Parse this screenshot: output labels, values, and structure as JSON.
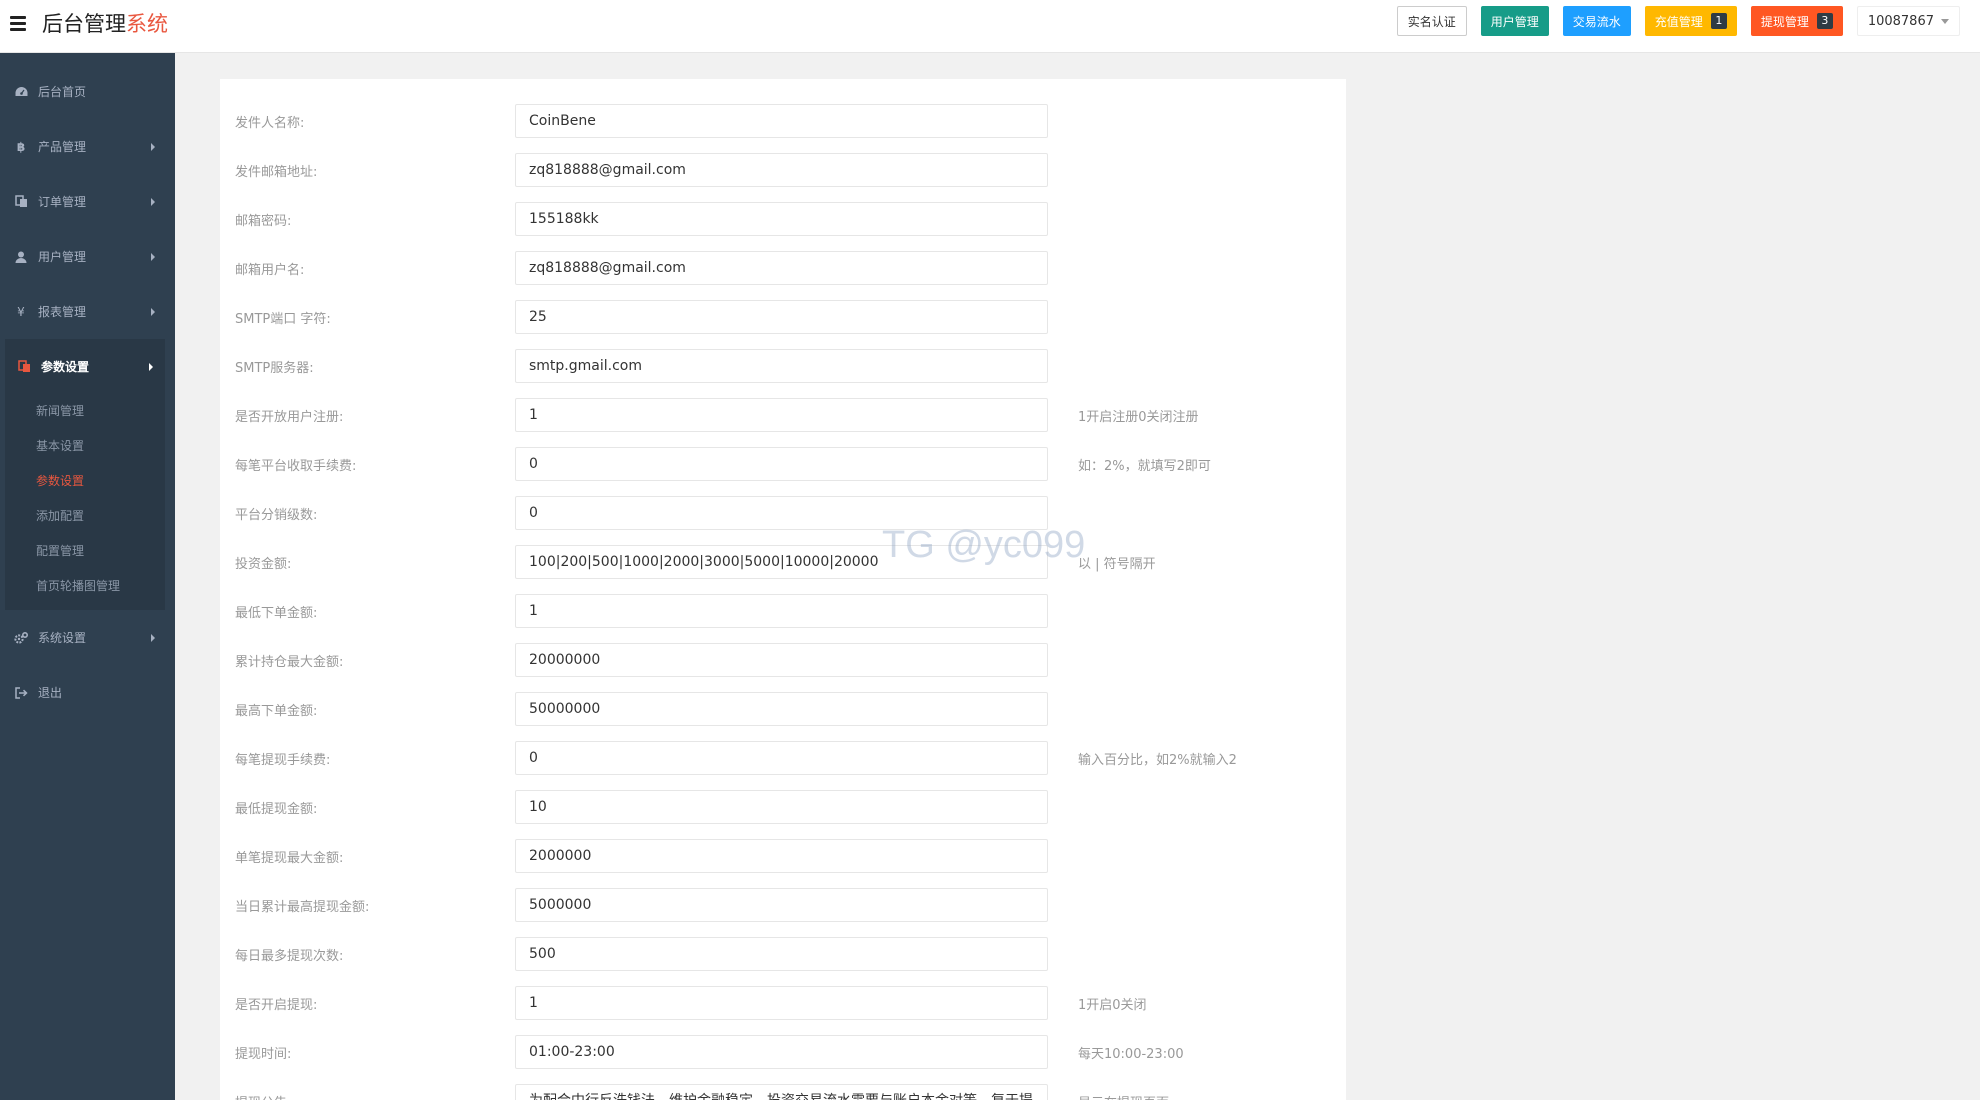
{
  "header": {
    "brand_main": "后台管理",
    "brand_accent": "系统",
    "buttons": [
      {
        "label": "实名认证",
        "badge": null
      },
      {
        "label": "用户管理",
        "badge": null
      },
      {
        "label": "交易流水",
        "badge": null
      },
      {
        "label": "充值管理",
        "badge": "1"
      },
      {
        "label": "提现管理",
        "badge": "3"
      }
    ],
    "user": "10087867"
  },
  "sidebar": {
    "items": [
      {
        "label": "后台首页",
        "icon": "dashboard-icon"
      },
      {
        "label": "产品管理",
        "icon": "bitcoin-icon"
      },
      {
        "label": "订单管理",
        "icon": "copy-icon"
      },
      {
        "label": "用户管理",
        "icon": "user-icon"
      },
      {
        "label": "报表管理",
        "icon": "yen-icon"
      },
      {
        "label": "参数设置",
        "icon": "files-icon"
      },
      {
        "label": "系统设置",
        "icon": "gears-icon"
      },
      {
        "label": "退出",
        "icon": "sign-out-icon"
      }
    ],
    "sub_items": [
      "新闻管理",
      "基本设置",
      "参数设置",
      "添加配置",
      "配置管理",
      "首页轮播图管理"
    ]
  },
  "form": {
    "rows": [
      {
        "label": "发件人名称:",
        "value": "CoinBene",
        "hint": ""
      },
      {
        "label": "发件邮箱地址:",
        "value": "zq818888@gmail.com",
        "hint": ""
      },
      {
        "label": "邮箱密码:",
        "value": "155188kk",
        "hint": ""
      },
      {
        "label": "邮箱用户名:",
        "value": "zq818888@gmail.com",
        "hint": ""
      },
      {
        "label": "SMTP端口 字符:",
        "value": "25",
        "hint": ""
      },
      {
        "label": "SMTP服务器:",
        "value": "smtp.gmail.com",
        "hint": ""
      },
      {
        "label": "是否开放用户注册:",
        "value": "1",
        "hint": "1开启注册0关闭注册"
      },
      {
        "label": "每笔平台收取手续费:",
        "value": "0",
        "hint": "如：2%，就填写2即可"
      },
      {
        "label": "平台分销级数:",
        "value": "0",
        "hint": ""
      },
      {
        "label": "投资金额:",
        "value": "100|200|500|1000|2000|3000|5000|10000|20000",
        "hint": "以 | 符号隔开"
      },
      {
        "label": "最低下单金额:",
        "value": "1",
        "hint": ""
      },
      {
        "label": "累计持仓最大金额:",
        "value": "20000000",
        "hint": ""
      },
      {
        "label": "最高下单金额:",
        "value": "50000000",
        "hint": ""
      },
      {
        "label": "每笔提现手续费:",
        "value": "0",
        "hint": "输入百分比，如2%就输入2"
      },
      {
        "label": "最低提现金额:",
        "value": "10",
        "hint": ""
      },
      {
        "label": "单笔提现最大金额:",
        "value": "2000000",
        "hint": ""
      },
      {
        "label": "当日累计最高提现金额:",
        "value": "5000000",
        "hint": ""
      },
      {
        "label": "每日最多提现次数:",
        "value": "500",
        "hint": ""
      },
      {
        "label": "是否开启提现:",
        "value": "1",
        "hint": "1开启0关闭"
      },
      {
        "label": "提现时间:",
        "value": "01:00-23:00",
        "hint": "每天10:00-23:00"
      },
      {
        "label": "提现公告:",
        "value": "为配合中行反洗钱法，维护金融稳定，投资交易流水需要与账户本金对等，复于提",
        "hint": "显示在提现页面"
      }
    ]
  },
  "watermark": "TG @yc099"
}
